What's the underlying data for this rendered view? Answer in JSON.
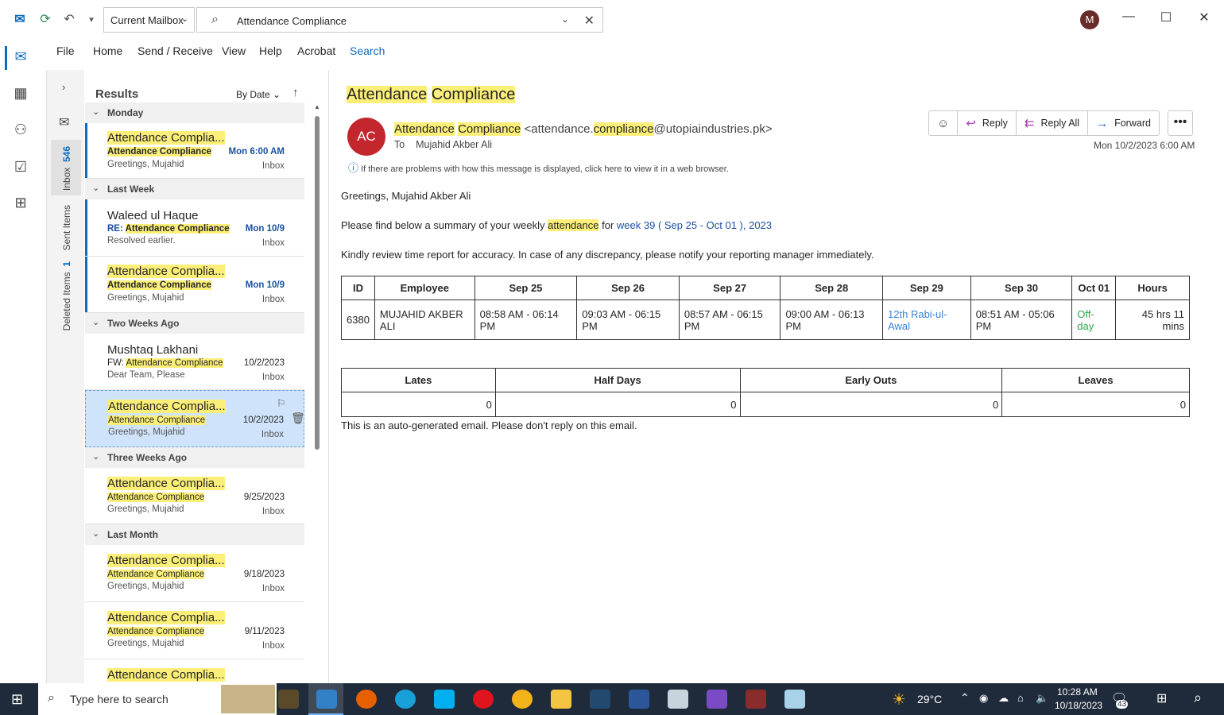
{
  "titlebar": {
    "mailbox": "Current Mailbox",
    "search_text": "Attendance Compliance",
    "avatar_initial": "M"
  },
  "ribbon": {
    "tabs": [
      "File",
      "Home",
      "Send / Receive",
      "View",
      "Help",
      "Acrobat",
      "Search"
    ]
  },
  "folders": {
    "inbox_label": "Inbox",
    "inbox_count": "546",
    "sent_label": "Sent Items",
    "deleted_label": "Deleted Items",
    "deleted_count": "1"
  },
  "list": {
    "title": "Results",
    "sort": "By Date",
    "groups": [
      "Monday",
      "Last Week",
      "Two Weeks Ago",
      "Three Weeks Ago",
      "Last Month"
    ],
    "items": [
      {
        "sender": "Attendance Complia...",
        "subject_prefix": "",
        "subject": "Attendance Compliance",
        "preview": "Greetings, Mujahid",
        "date": "Mon 6:00 AM",
        "folder": "Inbox"
      },
      {
        "sender": "Waleed ul Haque",
        "subject_prefix": "RE: ",
        "subject": "Attendance Compliance",
        "preview": "Resolved earlier.",
        "date": "Mon 10/9",
        "folder": "Inbox"
      },
      {
        "sender": "Attendance Complia...",
        "subject_prefix": "",
        "subject": "Attendance Compliance",
        "preview": "Greetings, Mujahid",
        "date": "Mon 10/9",
        "folder": "Inbox"
      },
      {
        "sender": "Mushtaq Lakhani",
        "subject_prefix": "FW: ",
        "subject": "Attendance Compliance",
        "preview": "Dear Team,  Please",
        "date": "10/2/2023",
        "folder": "Inbox"
      },
      {
        "sender": "Attendance Complia...",
        "subject_prefix": "",
        "subject": "Attendance Compliance",
        "preview": "Greetings, Mujahid",
        "date": "10/2/2023",
        "folder": "Inbox"
      },
      {
        "sender": "Attendance Complia...",
        "subject_prefix": "",
        "subject": "Attendance Compliance",
        "preview": "Greetings, Mujahid",
        "date": "9/25/2023",
        "folder": "Inbox"
      },
      {
        "sender": "Attendance Complia...",
        "subject_prefix": "",
        "subject": "Attendance Compliance",
        "preview": "Greetings, Mujahid",
        "date": "9/18/2023",
        "folder": "Inbox"
      },
      {
        "sender": "Attendance Complia...",
        "subject_prefix": "",
        "subject": "Attendance Compliance",
        "preview": "Greetings, Mujahid",
        "date": "9/11/2023",
        "folder": "Inbox"
      },
      {
        "sender": "Attendance Complia...",
        "subject_prefix": "",
        "subject": "",
        "preview": "",
        "date": "",
        "folder": ""
      }
    ]
  },
  "message": {
    "subject_a": "Attendance",
    "subject_b": "Compliance",
    "avatar": "AC",
    "from_a": "Attendance",
    "from_b": "Compliance",
    "email_a": "<attendance.",
    "email_b": "compliance",
    "email_c": "@utopiaindustries.pk>",
    "to_label": "To",
    "to": "Mujahid Akber Ali",
    "info": "If there are problems with how this message is displayed, click here to view it in a web browser.",
    "date": "Mon 10/2/2023 6:00 AM",
    "actions": [
      "Reply",
      "Reply All",
      "Forward"
    ],
    "greeting": "Greetings, Mujahid Akber Ali",
    "line1_a": "Please find below a summary of your weekly",
    "line1_hl": "attendance",
    "line1_b": "for",
    "line1_link": "week 39 ( Sep 25 - Oct 01 ), 2023",
    "line2": "Kindly review time report for accuracy. In case of any discrepancy, please notify your reporting manager immediately.",
    "table1": {
      "headers": [
        "ID",
        "Employee",
        "Sep 25",
        "Sep 26",
        "Sep 27",
        "Sep 28",
        "Sep 29",
        "Sep 30",
        "Oct 01",
        "Hours"
      ],
      "row": [
        "6380",
        "MUJAHID AKBER ALI",
        "08:58 AM - 06:14 PM",
        "09:03 AM - 06:15 PM",
        "08:57 AM - 06:15 PM",
        "09:00 AM - 06:13 PM",
        "12th Rabi-ul-Awal",
        "08:51 AM - 05:06 PM",
        "Off-day",
        "45 hrs 11 mins"
      ]
    },
    "table2": {
      "headers": [
        "Lates",
        "Half Days",
        "Early Outs",
        "Leaves"
      ],
      "row": [
        "0",
        "0",
        "0",
        "0"
      ]
    },
    "footer": "This is an auto-generated email. Please don't reply on this email."
  },
  "taskbar": {
    "search": "Type here to search",
    "temp": "29°C",
    "time": "10:28 AM",
    "date": "10/18/2023",
    "notif": "43"
  },
  "colors": {
    "accent": "#0f6cbd",
    "highlight": "#fbef7a",
    "selected": "#cfe4fa"
  }
}
